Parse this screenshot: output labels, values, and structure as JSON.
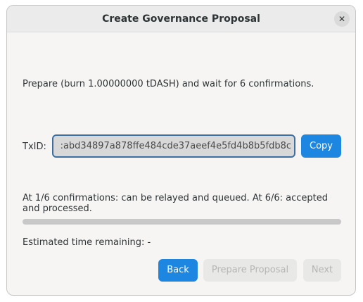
{
  "dialog": {
    "title": "Create Governance Proposal",
    "close_glyph": "✕"
  },
  "prepare": {
    "text": "Prepare (burn 1.00000000 tDASH) and wait for 6 confirmations."
  },
  "txid": {
    "label": "TxID:",
    "value": ":abd34897a878ffe484cde37aeef4e5fd4b8b5fdb8c",
    "copy_label": "Copy"
  },
  "confirmations": {
    "text": "At 1/6 confirmations: can be relayed and queued. At 6/6: accepted and processed.",
    "progress_fraction": 0
  },
  "estimate": {
    "text": "Estimated time remaining: -"
  },
  "footer": {
    "back_label": "Back",
    "prepare_label": "Prepare Proposal",
    "next_label": "Next"
  },
  "colors": {
    "accent": "#1c86e0",
    "disabled_text": "#b6b6b6",
    "progress_track": "#c8c8c8"
  }
}
